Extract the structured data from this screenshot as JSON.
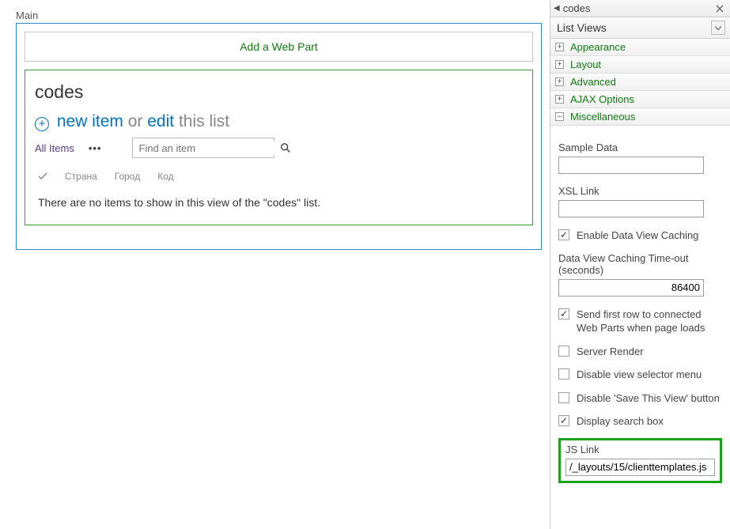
{
  "main": {
    "label": "Main",
    "add_webpart": "Add a Web Part",
    "title": "codes",
    "actions": {
      "new_item": "new item",
      "or": "or",
      "edit": "edit",
      "this_list": "this list"
    },
    "view_name": "All Items",
    "search_placeholder": "Find an item",
    "columns": [
      "Страна",
      "Город",
      "Код"
    ],
    "empty_message": "There are no items to show in this view of the \"codes\" list."
  },
  "panel": {
    "title": "codes",
    "subheader": "List Views",
    "sections": {
      "appearance": {
        "label": "Appearance",
        "expanded": false
      },
      "layout": {
        "label": "Layout",
        "expanded": false
      },
      "advanced": {
        "label": "Advanced",
        "expanded": false
      },
      "ajax": {
        "label": "AJAX Options",
        "expanded": false
      },
      "misc": {
        "label": "Miscellaneous",
        "expanded": true
      }
    },
    "misc": {
      "sample_data_label": "Sample Data",
      "sample_data_value": "",
      "xsl_link_label": "XSL Link",
      "xsl_link_value": "",
      "enable_caching_label": "Enable Data View Caching",
      "enable_caching_checked": true,
      "timeout_label": "Data View Caching Time-out (seconds)",
      "timeout_value": "86400",
      "send_first_row_label": "Send first row to connected Web Parts when page loads",
      "send_first_row_checked": true,
      "server_render_label": "Server Render",
      "server_render_checked": false,
      "disable_view_selector_label": "Disable view selector menu",
      "disable_view_selector_checked": false,
      "disable_save_view_label": "Disable 'Save This View' button",
      "disable_save_view_checked": false,
      "display_search_label": "Display search box",
      "display_search_checked": true,
      "js_link_label": "JS Link",
      "js_link_value": "/_layouts/15/clienttemplates.js"
    }
  }
}
